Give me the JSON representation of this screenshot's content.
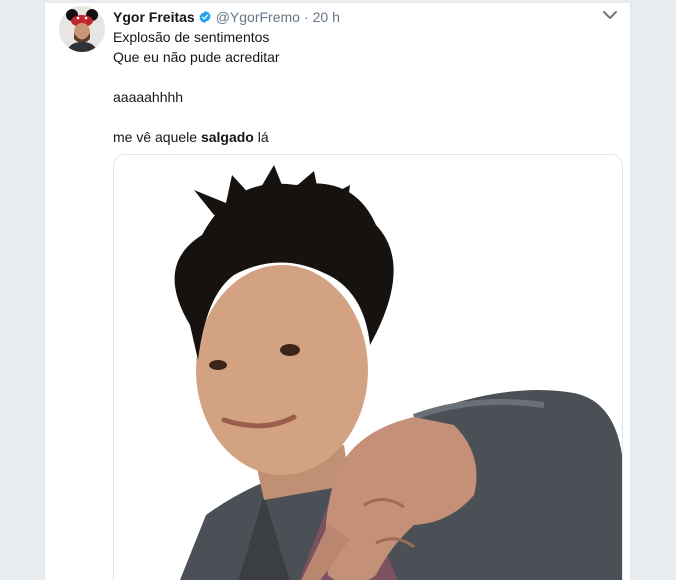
{
  "tweet": {
    "author_name": "Ygor Freitas",
    "handle": "@YgorFremo",
    "separator": "·",
    "time": "20 h",
    "lines": {
      "l1": "Explosão de sentimentos",
      "l2": "Que eu não pude acreditar",
      "l3": "aaaaahhhh",
      "l4_before": "me vê aquele ",
      "l4_bold": "salgado",
      "l4_after": " lá"
    }
  },
  "icons": {
    "verified": "verified-badge-icon",
    "chevron": "chevron-down-icon"
  },
  "colors": {
    "background": "#e6ecf0",
    "text": "#14171a",
    "muted": "#657786",
    "verified": "#1da1f2"
  }
}
